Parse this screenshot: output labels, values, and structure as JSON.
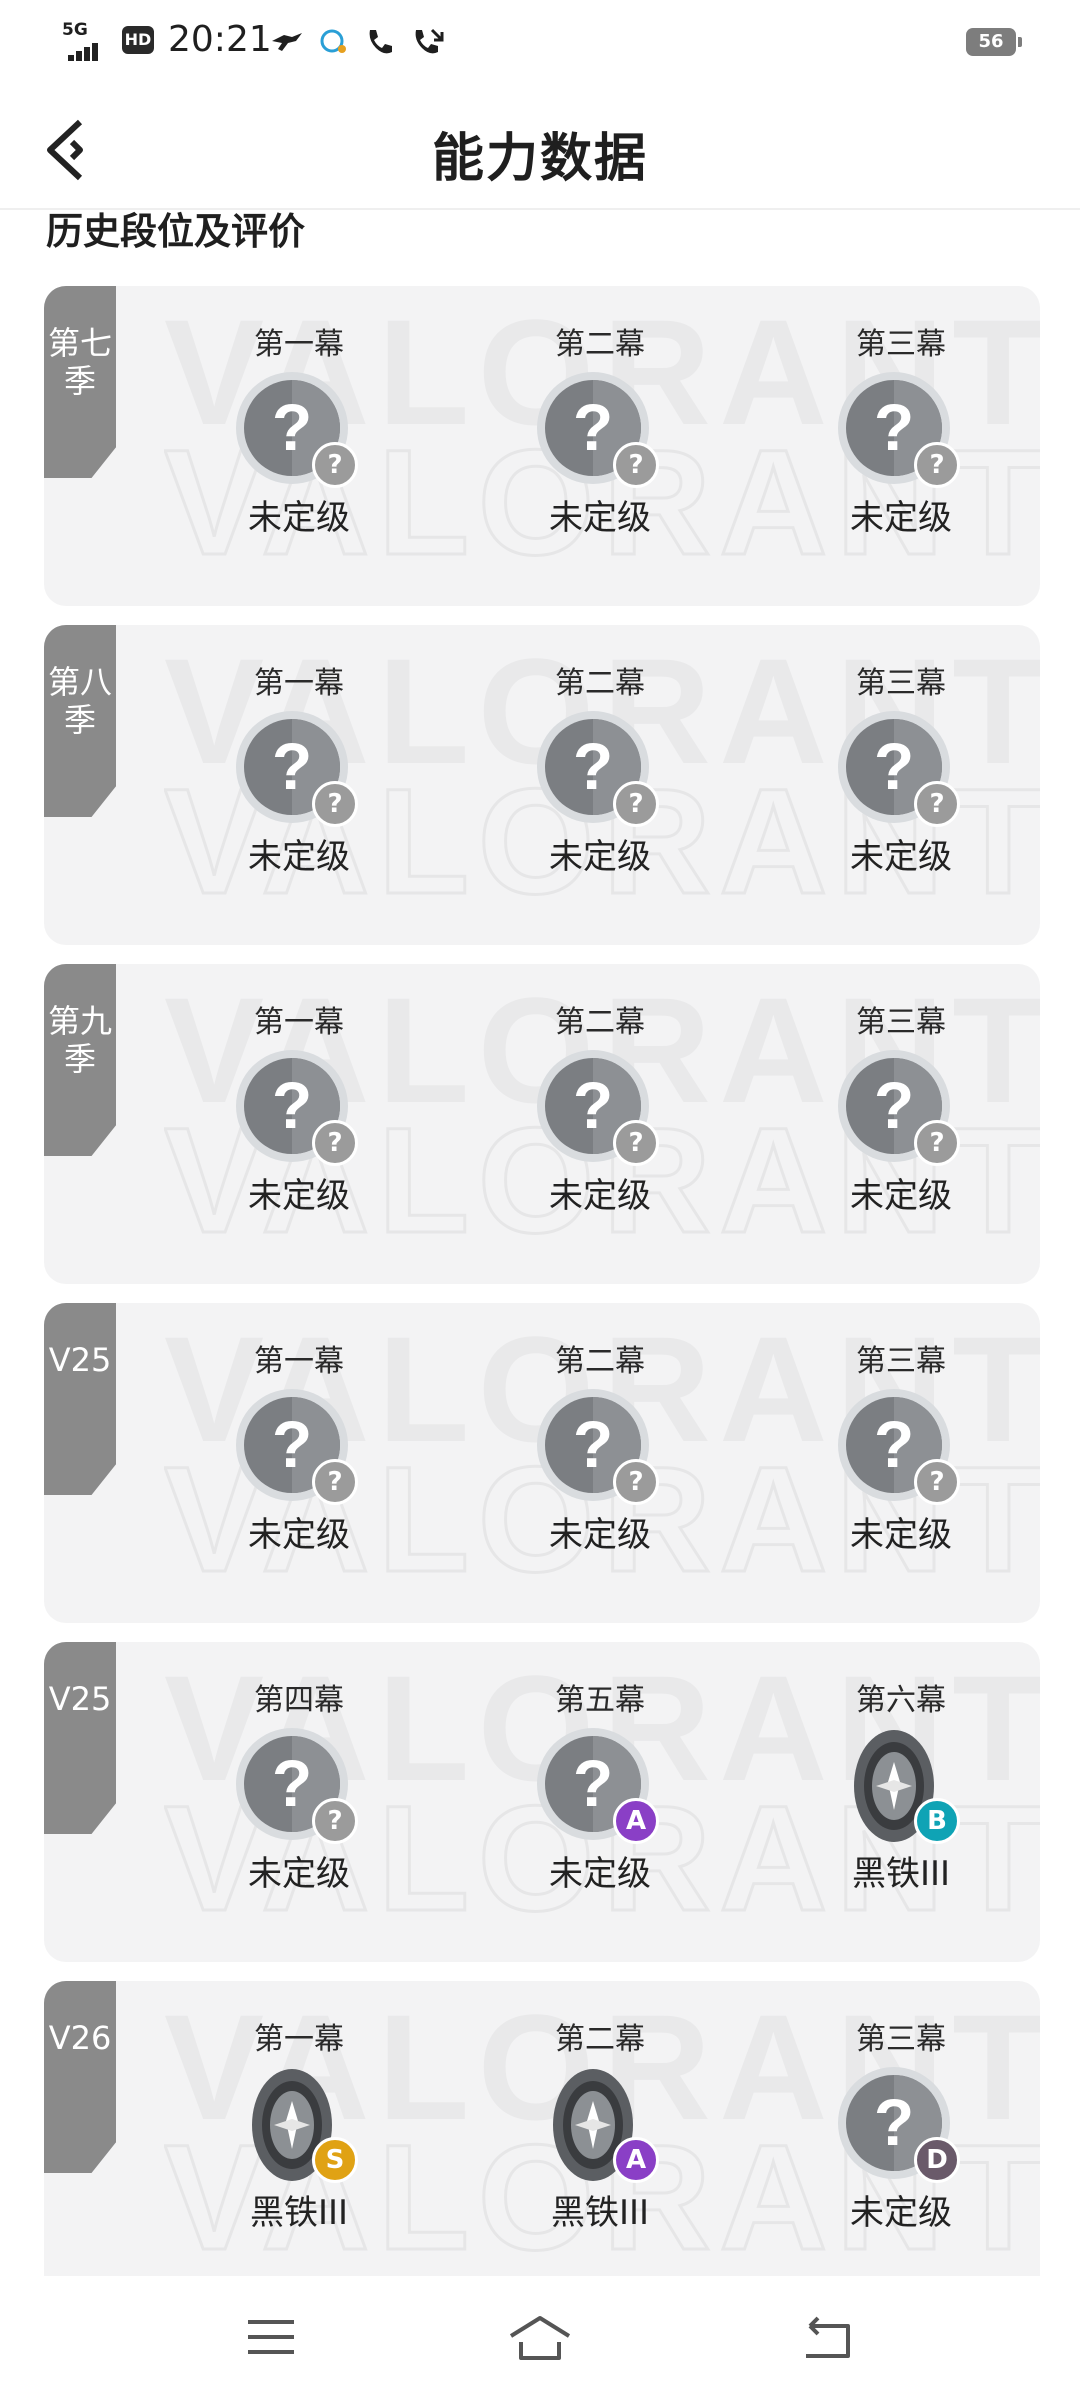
{
  "status_bar": {
    "network": "5G",
    "hd": "HD",
    "time": "20:21",
    "battery": "56"
  },
  "header": {
    "title": "能力数据"
  },
  "section_title": "历史段位及评价",
  "seasons": [
    {
      "tag": "第七季",
      "acts": [
        {
          "label": "第一幕",
          "rank": "未定级",
          "icon": "unranked-icon",
          "badge": "?",
          "badge_color": "#9b9b9b"
        },
        {
          "label": "第二幕",
          "rank": "未定级",
          "icon": "unranked-icon",
          "badge": "?",
          "badge_color": "#9b9b9b"
        },
        {
          "label": "第三幕",
          "rank": "未定级",
          "icon": "unranked-icon",
          "badge": "?",
          "badge_color": "#9b9b9b"
        }
      ]
    },
    {
      "tag": "第八季",
      "acts": [
        {
          "label": "第一幕",
          "rank": "未定级",
          "icon": "unranked-icon",
          "badge": "?",
          "badge_color": "#9b9b9b"
        },
        {
          "label": "第二幕",
          "rank": "未定级",
          "icon": "unranked-icon",
          "badge": "?",
          "badge_color": "#9b9b9b"
        },
        {
          "label": "第三幕",
          "rank": "未定级",
          "icon": "unranked-icon",
          "badge": "?",
          "badge_color": "#9b9b9b"
        }
      ]
    },
    {
      "tag": "第九季",
      "acts": [
        {
          "label": "第一幕",
          "rank": "未定级",
          "icon": "unranked-icon",
          "badge": "?",
          "badge_color": "#9b9b9b"
        },
        {
          "label": "第二幕",
          "rank": "未定级",
          "icon": "unranked-icon",
          "badge": "?",
          "badge_color": "#9b9b9b"
        },
        {
          "label": "第三幕",
          "rank": "未定级",
          "icon": "unranked-icon",
          "badge": "?",
          "badge_color": "#9b9b9b"
        }
      ]
    },
    {
      "tag": "V25",
      "acts": [
        {
          "label": "第一幕",
          "rank": "未定级",
          "icon": "unranked-icon",
          "badge": "?",
          "badge_color": "#9b9b9b"
        },
        {
          "label": "第二幕",
          "rank": "未定级",
          "icon": "unranked-icon",
          "badge": "?",
          "badge_color": "#9b9b9b"
        },
        {
          "label": "第三幕",
          "rank": "未定级",
          "icon": "unranked-icon",
          "badge": "?",
          "badge_color": "#9b9b9b"
        }
      ]
    },
    {
      "tag": "V25",
      "acts": [
        {
          "label": "第四幕",
          "rank": "未定级",
          "icon": "unranked-icon",
          "badge": "?",
          "badge_color": "#9b9b9b"
        },
        {
          "label": "第五幕",
          "rank": "未定级",
          "icon": "unranked-icon",
          "badge": "A",
          "badge_color": "#8a3fc6"
        },
        {
          "label": "第六幕",
          "rank": "黑铁III",
          "icon": "iron-rank-icon",
          "badge": "B",
          "badge_color": "#0fa3b5"
        }
      ]
    },
    {
      "tag": "V26",
      "acts": [
        {
          "label": "第一幕",
          "rank": "黑铁III",
          "icon": "iron-rank-icon",
          "badge": "S",
          "badge_color": "#e0a214"
        },
        {
          "label": "第二幕",
          "rank": "黑铁III",
          "icon": "iron-rank-icon",
          "badge": "A",
          "badge_color": "#8a3fc6"
        },
        {
          "label": "第三幕",
          "rank": "未定级",
          "icon": "unranked-icon",
          "badge": "D",
          "badge_color": "#6a5a6a"
        }
      ]
    }
  ],
  "watermark": "VALORANT"
}
